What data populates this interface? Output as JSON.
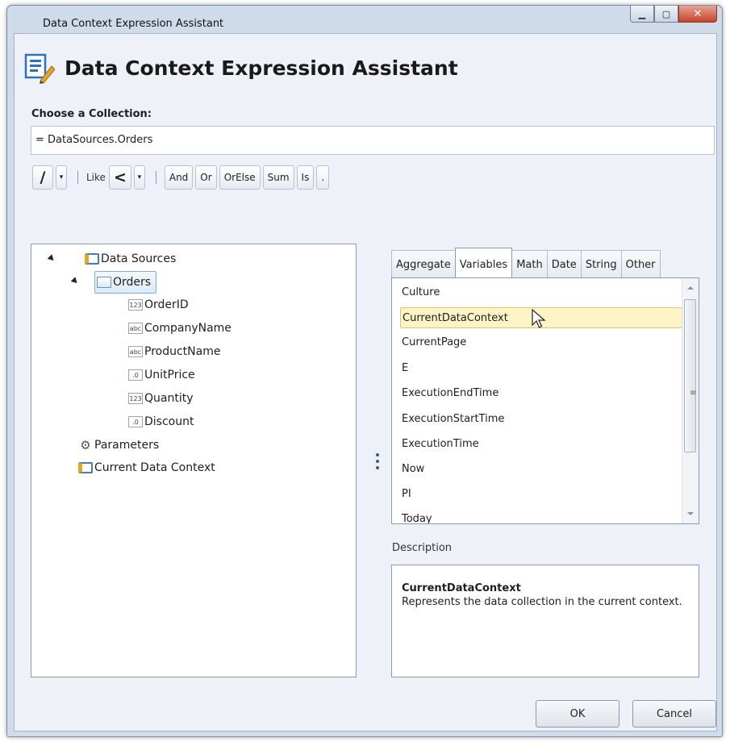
{
  "window": {
    "title": "Data Context Expression Assistant",
    "minimize_glyph": "▁",
    "maximize_glyph": "▢",
    "close_glyph": "✕"
  },
  "header": {
    "title": "Data Context Expression Assistant",
    "icon": "expression-editor-icon"
  },
  "collection": {
    "label": "Choose a Collection:",
    "value": "= DataSources.Orders"
  },
  "toolbar": {
    "divide": "/",
    "dropdown_arrow": "▾",
    "like": "Like",
    "less_than": "<",
    "and": "And",
    "or": "Or",
    "orelse": "OrElse",
    "sum": "Sum",
    "is": "Is",
    "dot": "."
  },
  "tree": {
    "data_sources": "Data Sources",
    "orders": "Orders",
    "fields": [
      {
        "type_badge": "123",
        "name": "OrderID"
      },
      {
        "type_badge": "abc",
        "name": "CompanyName"
      },
      {
        "type_badge": "abc",
        "name": "ProductName"
      },
      {
        "type_badge": ".0",
        "name": "UnitPrice"
      },
      {
        "type_badge": "123",
        "name": "Quantity"
      },
      {
        "type_badge": ".0",
        "name": "Discount"
      }
    ],
    "parameters": "Parameters",
    "current_data_context": "Current Data Context"
  },
  "tabs": [
    {
      "label": "Aggregate"
    },
    {
      "label": "Variables"
    },
    {
      "label": "Math"
    },
    {
      "label": "Date"
    },
    {
      "label": "String"
    },
    {
      "label": "Other"
    }
  ],
  "active_tab": "Variables",
  "variables": [
    "Culture",
    "CurrentDataContext",
    "CurrentPage",
    "E",
    "ExecutionEndTime",
    "ExecutionStartTime",
    "ExecutionTime",
    "Now",
    "PI",
    "Today"
  ],
  "selected_variable": "CurrentDataContext",
  "description": {
    "label": "Description",
    "title": "CurrentDataContext",
    "text": "Represents the data collection in the current context."
  },
  "buttons": {
    "ok": "OK",
    "cancel": "Cancel"
  }
}
